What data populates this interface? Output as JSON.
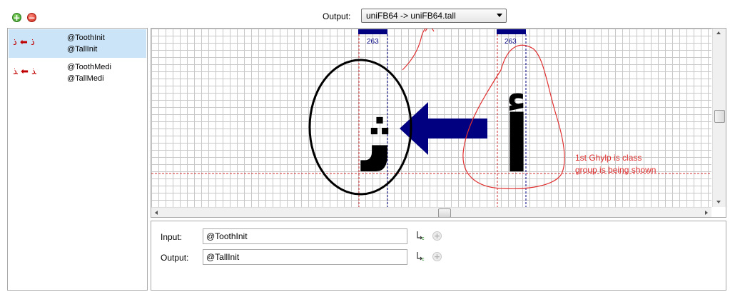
{
  "toolbar": {
    "add_icon": "plus-circle-icon",
    "remove_icon": "minus-circle-icon",
    "add_symbol": "+",
    "remove_symbol": "−"
  },
  "output_selector": {
    "label": "Output:",
    "selected": "uniFB64 -> uniFB64.tall"
  },
  "rules": [
    {
      "glyphs": "ﺫ ⬅ ﺫ",
      "input": "@ToothInit",
      "output": "@TallInit",
      "selected": true
    },
    {
      "glyphs": "ﺬ ⬅ ﺬ",
      "input": "@ToothMedi",
      "output": "@TallMedi",
      "selected": false
    }
  ],
  "canvas": {
    "left_glyph_width": "263",
    "right_glyph_width": "263",
    "output_glyph": "ﺛ",
    "input_glyph": "ﺃ",
    "annotation_line1": "1st Ghylp is class",
    "annotation_line2": "group is being shown",
    "colors": {
      "guide_bar": "#000080",
      "arrow": "#000080",
      "annotation": "#e03030",
      "baseline": "#d03030"
    }
  },
  "fields": {
    "input_label": "Input:",
    "input_value": "@ToothInit",
    "output_label": "Output:",
    "output_value": "@TallInit",
    "class_icon": "class-picker-icon",
    "add_icon": "plus-circle-icon"
  }
}
